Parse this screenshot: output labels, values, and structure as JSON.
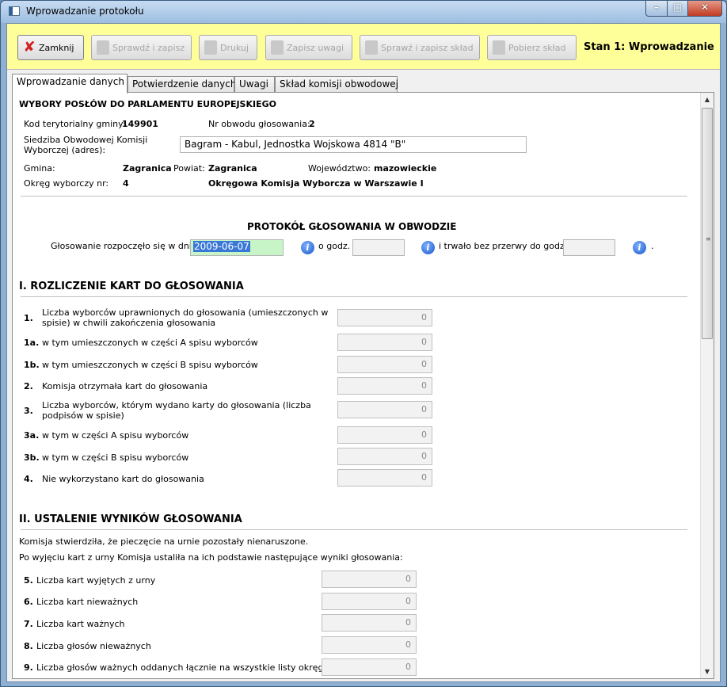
{
  "window": {
    "title": "Wprowadzanie protokołu"
  },
  "toolbar": {
    "close_label": "Zamknij",
    "check_save_label": "Sprawdź i zapisz",
    "print_label": "Drukuj",
    "save_notes_label": "Zapisz uwagi",
    "check_save_committee_label": "Sprawź i zapisz skład",
    "fetch_committee_label": "Pobierz skład",
    "state_label": "Stan 1: Wprowadzanie"
  },
  "tabs": [
    {
      "label": "Wprowadzanie danych"
    },
    {
      "label": "Potwierdzenie danych"
    },
    {
      "label": "Uwagi"
    },
    {
      "label": "Skład komisji obwodowej"
    }
  ],
  "header": {
    "election_title": "WYBORY POSŁÓW DO PARLAMENTU EUROPEJSKIEGO",
    "territorial_code_label": "Kod terytorialny gminy:",
    "territorial_code": "149901",
    "district_no_label": "Nr obwodu głosowania:",
    "district_no": "2",
    "seat_label_1": "Siedziba Obwodowej Komisji",
    "seat_label_2": "Wyborczej (adres):",
    "seat_value": "Bagram - Kabul, Jednostka Wojskowa 4814 \"B\"",
    "gmina_label": "Gmina:",
    "gmina_value": "Zagranica",
    "powiat_label": "Powiat:",
    "powiat_value": "Zagranica",
    "voivodeship_label": "Województwo:",
    "voivodeship_value": "mazowieckie",
    "constituency_label": "Okręg wyborczy nr:",
    "constituency_value": "4",
    "commission_name": "Okręgowa Komisja Wyborcza w Warszawie I"
  },
  "protocol": {
    "title": "PROTOKÓŁ GŁOSOWANIA W OBWODZIE",
    "start_label": "Głosowanie rozpoczęło się w dniu",
    "start_date": "2009-06-07",
    "hour_label": "o godz.",
    "hour_value": "",
    "until_label": "i trwało bez przerwy do godz.",
    "until_value": "",
    "end_dot": "."
  },
  "section1": {
    "title": "I. ROZLICZENIE KART DO GŁOSOWANIA",
    "rows": [
      {
        "num": "1.",
        "label": "Liczba wyborców uprawnionych do głosowania (umieszczonych w spisie) w chwili zakończenia głosowania",
        "value": "0"
      },
      {
        "num": "1a.",
        "label": "w tym umieszczonych w części A spisu wyborców",
        "value": "0"
      },
      {
        "num": "1b.",
        "label": "w tym umieszczonych w części B spisu wyborców",
        "value": "0"
      },
      {
        "num": "2.",
        "label": "Komisja otrzymała kart do głosowania",
        "value": "0"
      },
      {
        "num": "3.",
        "label": "Liczba wyborców, którym wydano karty do głosowania (liczba podpisów w spisie)",
        "value": "0"
      },
      {
        "num": "3a.",
        "label": "w tym w części A spisu wyborców",
        "value": "0"
      },
      {
        "num": "3b.",
        "label": "w tym w części B spisu wyborców",
        "value": "0"
      },
      {
        "num": "4.",
        "label": "Nie wykorzystano kart do głosowania",
        "value": "0"
      }
    ]
  },
  "section2": {
    "title": "II. USTALENIE WYNIKÓW GŁOSOWANIA",
    "line1": "Komisja stwierdziła, że pieczęcie na urnie pozostały nienaruszone.",
    "line2": "Po wyjęciu kart z urny Komisja ustaliła na ich podstawie następujące wyniki głosowania:",
    "rows": [
      {
        "num": "5.",
        "label": "Liczba kart wyjętych z urny",
        "value": "0"
      },
      {
        "num": "6.",
        "label": "Liczba kart nieważnych",
        "value": "0"
      },
      {
        "num": "7.",
        "label": "Liczba kart ważnych",
        "value": "0"
      },
      {
        "num": "8.",
        "label": "Liczba głosów nieważnych",
        "value": "0"
      },
      {
        "num": "9.",
        "label": "Liczba głosów ważnych oddanych łącznie na wszystkie listy okręgowe",
        "value": "0"
      }
    ]
  }
}
